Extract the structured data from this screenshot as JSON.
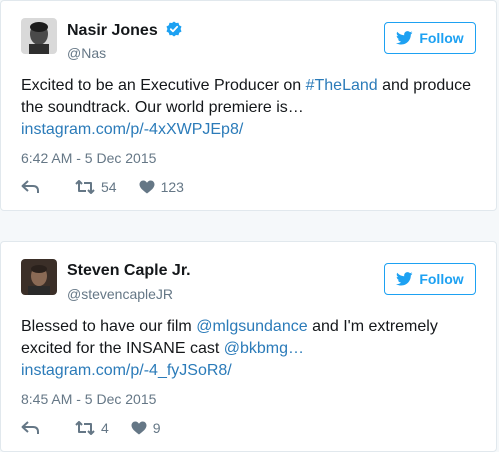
{
  "colors": {
    "link": "#2b7bb9",
    "brand": "#1da1f2",
    "secondary_text": "#657786",
    "verified": "#1da1f2"
  },
  "tweets": [
    {
      "name": "Nasir Jones",
      "verified": true,
      "handle": "@Nas",
      "follow_label": "Follow",
      "text_before": "Excited to be an Executive Producer on ",
      "hashtag": "#TheLand",
      "text_middle": " and produce the soundtrack. Our world premiere is… ",
      "link": "instagram.com/p/-4xXWPJEp8/",
      "timestamp": "6:42 AM - 5 Dec 2015",
      "retweets": "54",
      "likes": "123",
      "icons": [
        "avatar-portrait",
        "verified-badge-icon",
        "bird-icon",
        "reply-icon",
        "retweet-icon",
        "heart-icon"
      ]
    },
    {
      "name": "Steven Caple Jr.",
      "verified": false,
      "handle": "@stevencapleJR",
      "follow_label": "Follow",
      "text_before": "Blessed to have our film ",
      "mention1": "@mlgsundance",
      "text_middle": " and I'm extremely excited for the INSANE cast ",
      "mention2": "@bkbmg…",
      "text_space": " ",
      "link": "instagram.com/p/-4_fyJSoR8/",
      "timestamp": "8:45 AM - 5 Dec 2015",
      "retweets": "4",
      "likes": "9",
      "icons": [
        "avatar-portrait",
        "bird-icon",
        "reply-icon",
        "retweet-icon",
        "heart-icon"
      ]
    }
  ]
}
